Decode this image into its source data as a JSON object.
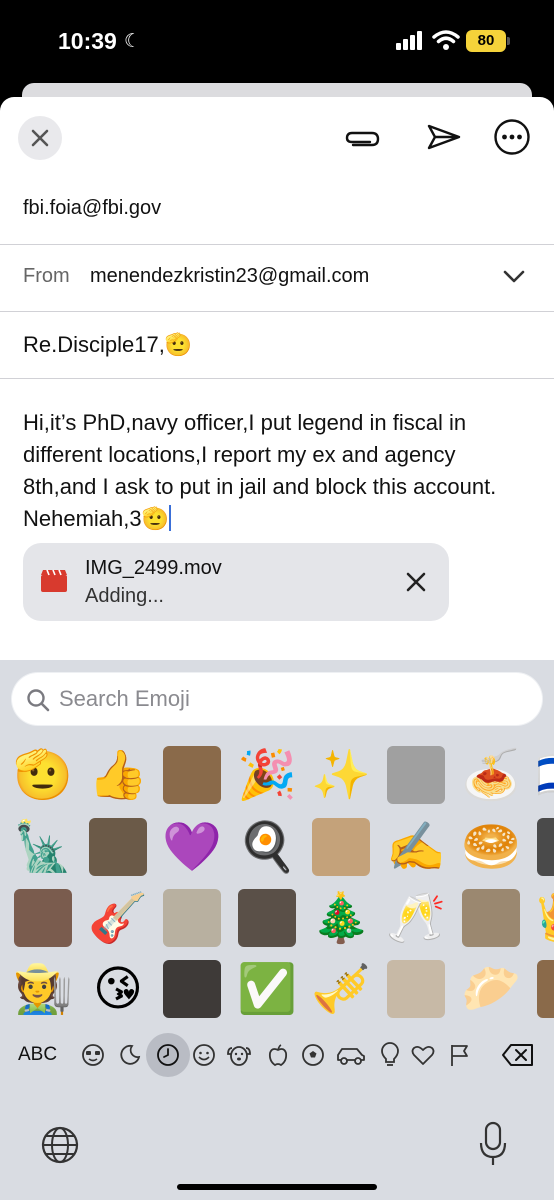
{
  "status_bar": {
    "time": "10:39",
    "battery": "80"
  },
  "compose": {
    "to": "fbi.foia@fbi.gov",
    "from_label": "From",
    "from_value": "menendezkristin23@gmail.com",
    "subject": "Re.Disciple17,🫡",
    "body": "Hi,it’s PhD,navy officer,I put legend in fiscal in different locations,I report my ex and agency 8th,and I ask to put in jail and block this account. Nehemiah,3🫡",
    "attachment": {
      "name": "IMG_2499.mov",
      "status": "Adding..."
    }
  },
  "keyboard": {
    "search_placeholder": "Search Emoji",
    "abc_label": "ABC",
    "emoji_rows": [
      [
        "🫡",
        "👍",
        "sticker",
        "🎉",
        "✨",
        "sticker",
        "🍝",
        "🇮🇱"
      ],
      [
        "🗽",
        "sticker",
        "💜",
        "🍳",
        "sticker",
        "✍️",
        "🥯",
        "sticker"
      ],
      [
        "sticker",
        "🎸",
        "sticker",
        "sticker",
        "🎄",
        "🥂",
        "sticker",
        "👑"
      ],
      [
        "🧑‍🌾",
        "😘",
        "sticker",
        "✅",
        "🎺",
        "sticker",
        "🥟",
        "sticker"
      ]
    ],
    "categories": [
      "smileys-people",
      "animals-nature",
      "recents",
      "smiley",
      "dog",
      "apple",
      "soccer",
      "car",
      "bulb",
      "heart",
      "flag"
    ],
    "colors": {
      "accent": "#3a6fd8",
      "keyboard_bg": "#d9dce2",
      "battery": "#f5d33a",
      "attachment_icon": "#d83a2e"
    }
  }
}
